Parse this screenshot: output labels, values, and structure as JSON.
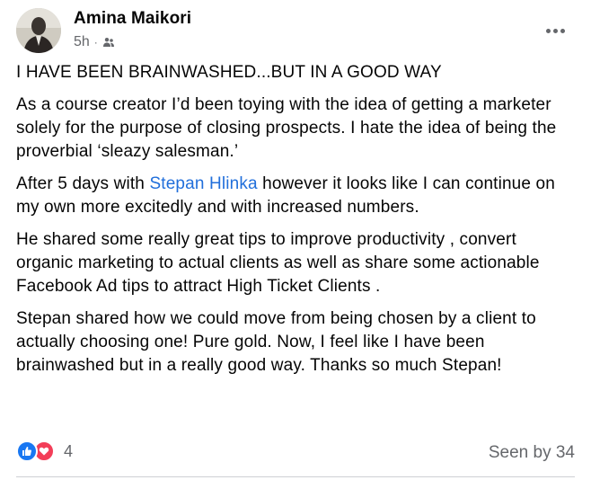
{
  "post": {
    "author": "Amina Maikori",
    "time": "5h",
    "separator": "·",
    "privacy_icon": "friends-icon",
    "more_icon": "ellipsis-icon",
    "title": "I HAVE BEEN BRAINWASHED...BUT IN A GOOD WAY",
    "paragraph1": "As a course creator I’d been toying with the idea of getting a marketer solely for the purpose of closing prospects. I hate  the idea of being the proverbial ‘sleazy salesman.’",
    "paragraph2_before": "After 5 days with ",
    "mention": "Stepan Hlinka",
    "paragraph2_after": " however it looks like I can continue on my own more excitedly and with increased numbers.",
    "paragraph3": "He shared some really great tips to improve productivity , convert organic marketing to actual clients as well as share some actionable Facebook Ad tips to attract High Ticket Clients .",
    "paragraph4": "Stepan shared how we could move from being chosen by a client to actually choosing one! Pure gold. Now, I feel like I have been brainwashed but in a really good way. Thanks so much Stepan!"
  },
  "footer": {
    "reaction_icons": [
      "like-icon",
      "love-icon"
    ],
    "reaction_count": "4",
    "seen_by": "Seen by 34"
  },
  "colors": {
    "text": "#050505",
    "secondary": "#65676b",
    "link": "#216fdb",
    "like": "#1877f2",
    "love": "#f33e58"
  }
}
